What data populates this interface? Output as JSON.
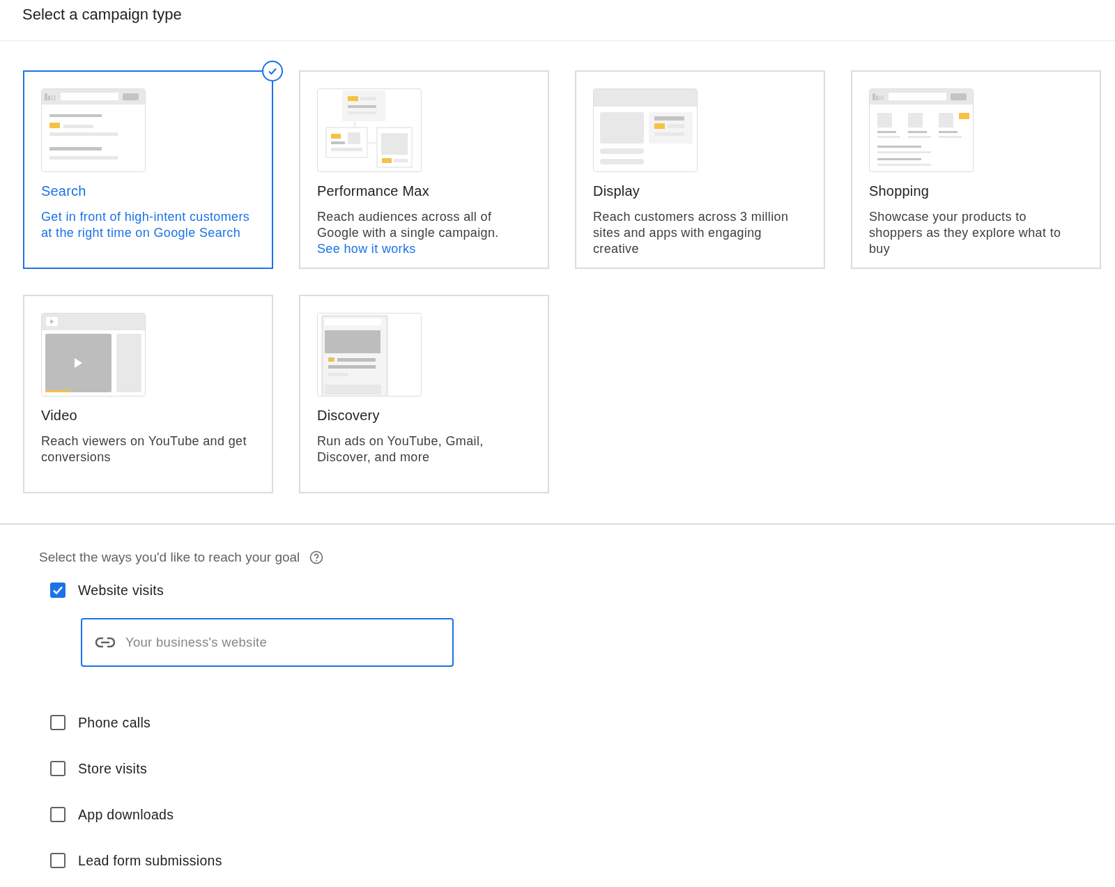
{
  "header": {
    "title": "Select a campaign type"
  },
  "campaign_types": [
    {
      "kind": "search",
      "title": "Search",
      "description": "Get in front of high-intent customers at the right time on Google Search",
      "selected": true
    },
    {
      "kind": "pmax",
      "title": "Performance Max",
      "description": "Reach audiences across all of Google with a single campaign.",
      "link": "See how it works",
      "selected": false
    },
    {
      "kind": "display",
      "title": "Display",
      "description": "Reach customers across 3 million sites and apps with engaging creative",
      "selected": false
    },
    {
      "kind": "shopping",
      "title": "Shopping",
      "description": "Showcase your products to shoppers as they explore what to buy",
      "selected": false
    },
    {
      "kind": "video",
      "title": "Video",
      "description": "Reach viewers on YouTube and get conversions",
      "selected": false
    },
    {
      "kind": "discovery",
      "title": "Discovery",
      "description": "Run ads on YouTube, Gmail, Discover, and more",
      "selected": false
    }
  ],
  "goals": {
    "heading": "Select the ways you'd like to reach your goal",
    "options": [
      {
        "label": "Website visits",
        "checked": true,
        "field": {
          "placeholder": "Your business's website"
        }
      },
      {
        "label": "Phone calls",
        "checked": false
      },
      {
        "label": "Store visits",
        "checked": false
      },
      {
        "label": "App downloads",
        "checked": false
      },
      {
        "label": "Lead form submissions",
        "checked": false
      }
    ]
  }
}
